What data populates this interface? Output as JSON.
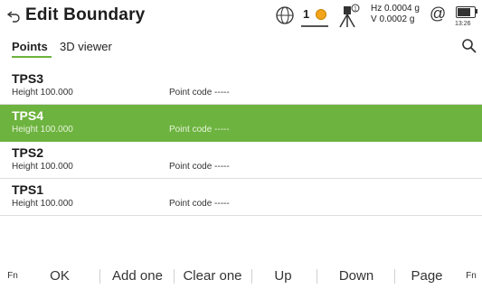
{
  "header": {
    "title": "Edit Boundary",
    "sat_count": "1",
    "angle_hz": "Hz 0.0004 g",
    "angle_v": "V  0.0002 g",
    "at_symbol": "@",
    "clock": "13:26"
  },
  "tabs": [
    {
      "label": "Points"
    },
    {
      "label": "3D viewer"
    }
  ],
  "points": [
    {
      "name": "TPS3",
      "height": "Height  100.000",
      "code": "Point code  -----"
    },
    {
      "name": "TPS4",
      "height": "Height  100.000",
      "code": "Point code  -----",
      "selected": true
    },
    {
      "name": "TPS2",
      "height": "Height  100.000",
      "code": "Point code  -----"
    },
    {
      "name": "TPS1",
      "height": "Height  100.000",
      "code": "Point code  -----"
    }
  ],
  "bottombar": {
    "fn_left": "Fn",
    "ok": "OK",
    "add_one": "Add one",
    "clear_one": "Clear one",
    "up": "Up",
    "down": "Down",
    "page": "Page",
    "fn_right": "Fn"
  },
  "colors": {
    "accent": "#6db33f",
    "satellite_dot": "#f2a51a"
  }
}
